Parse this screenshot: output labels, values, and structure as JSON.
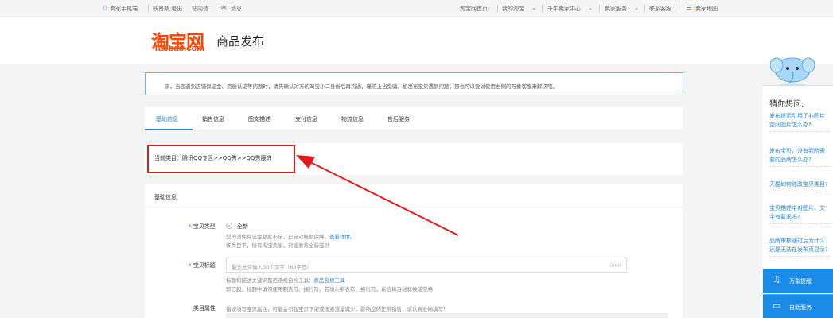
{
  "topbar": {
    "mobile": "卖家手机端",
    "user": "妖景斯,退出",
    "inbox": "站内信",
    "message": "消息",
    "home": "淘宝网首页",
    "my_taobao": "我的淘宝",
    "seller_center": "千牛卖家中心",
    "seller_service": "卖家服务",
    "contact": "联系客服",
    "sitemap": "卖家地图"
  },
  "header": {
    "logo_cn": "淘宝网",
    "logo_en": "Taobao.com",
    "title": "商品发布"
  },
  "notice": "亲，当您遇到店铺保证金、资质认证等问题时，请先确认对方的淘宝小二身份后再沟通，谨防上当受骗。如发布宝贝遇到问题，您也可以尝试使用右侧的万象客服来解决哦。",
  "tabs": [
    "基础信息",
    "销售信息",
    "图文描述",
    "支付信息",
    "物流信息",
    "售后服务"
  ],
  "category": "当前类目：腾讯QQ专区>>QQ秀>>QQ秀服饰",
  "form": {
    "section": "基础信息",
    "type_label": "宝贝类型",
    "type_value": "全新",
    "type_hint1": "您的消保保证金额度不足，已启动账期保障，",
    "type_hint1_link": "查看详情。",
    "type_hint2": "该类目下，所有淘宝卖家，只能发布全新宝贝",
    "title_label": "宝贝标题",
    "title_placeholder": "最多允许输入30个汉字（60字符）",
    "title_counter": "0/60",
    "title_hint1": "标题和描述关键词是否违规自检工具：",
    "title_hint1_link": "商品合规工具",
    "title_hint2": "即日起，标题中请勿使用制表符、换行符。若填入制表符、换行符，系统将自动替换成空格",
    "attr_label": "类目属性",
    "attr_hint": "错误填写宝贝属性，可能会引起宝贝下架或搜索流量减少，影响您的正常销售，请认真准确填写！"
  },
  "sidebar": {
    "title": "猜你想问:",
    "questions": [
      "发布提示引用了非图片空间图片怎么办?",
      "发布宝贝，没有我所需要的品牌怎么办?",
      "天猫如何修改宝贝类目?",
      "宝贝描述中对图片、文字有要求吗?",
      "品牌审核通过后为什么还是无法在发布页显示?"
    ],
    "btn1": "万象提醒",
    "btn2": "自助服务"
  },
  "colors": {
    "brand": "#ff4400",
    "accent": "#2a84d6",
    "annotation": "#e21b1b"
  }
}
